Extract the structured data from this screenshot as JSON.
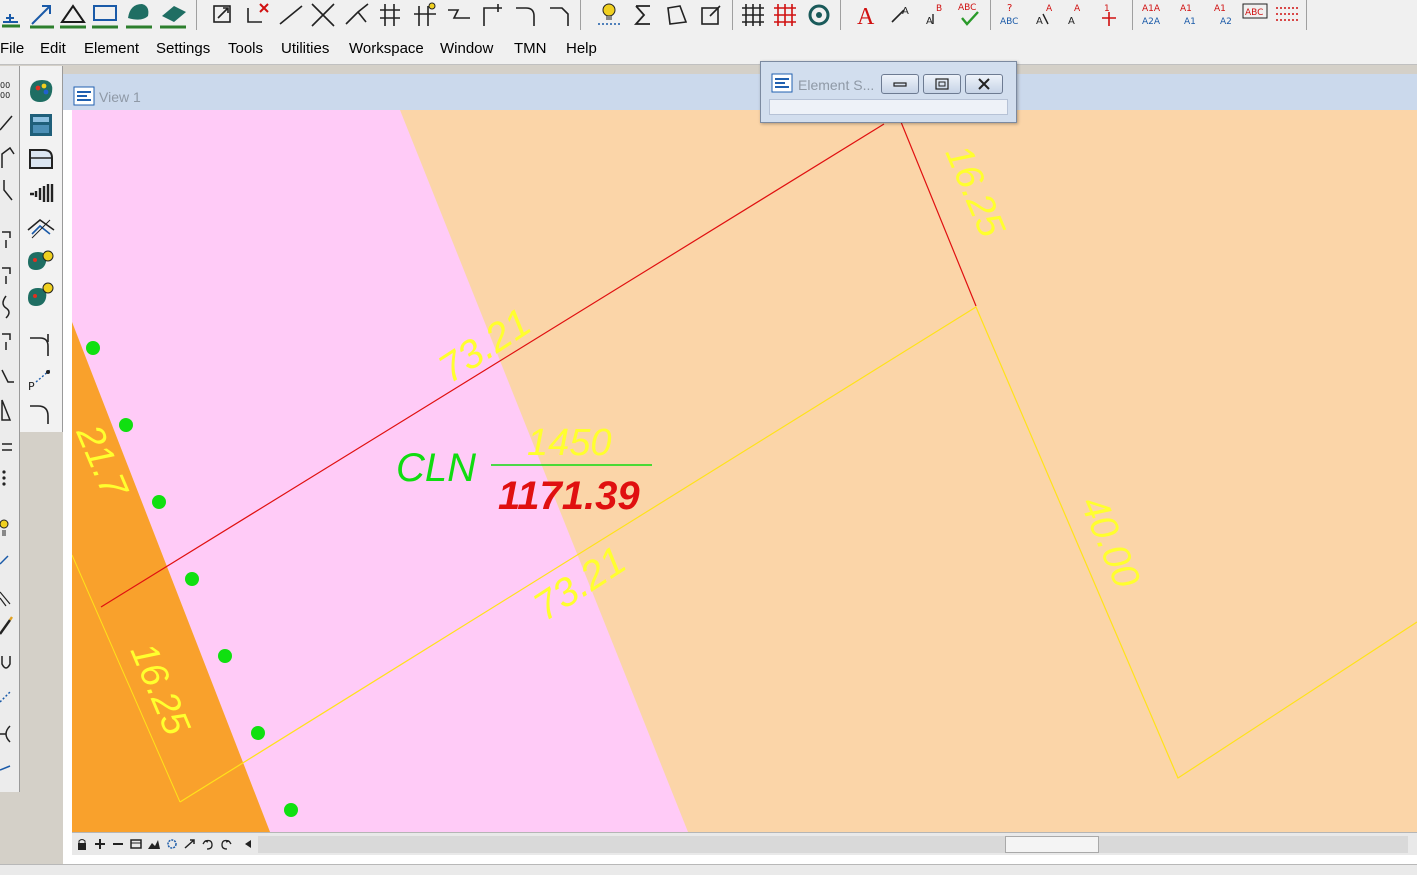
{
  "menu": {
    "items": [
      "File",
      "Edit",
      "Element",
      "Settings",
      "Tools",
      "Utilities",
      "Workspace",
      "Window",
      "TMN",
      "Help"
    ]
  },
  "toolbar_icons": {
    "text_tools": [
      "text-place-icon",
      "text-edit-icon",
      "text-spell-icon"
    ],
    "abc_labels": [
      "ABC",
      "ABC",
      "A1A",
      "A2A",
      "A1",
      "A1",
      "A1",
      "A2",
      "ABC"
    ]
  },
  "view": {
    "title": "View 1"
  },
  "element_window": {
    "title": "Element S..."
  },
  "drawing": {
    "colors": {
      "parcel_orange_light": "#fbd5a8",
      "parcel_pink": "#ffcbf7",
      "parcel_orange_dark": "#f9a12c",
      "boundary_red": "#e01010",
      "boundary_yellow": "#ffff2e",
      "point_green": "#10e010",
      "label_green": "#10dc10",
      "area_red": "#e01010"
    },
    "labels": {
      "top_dim": "73.21",
      "bottom_dim": "73.21",
      "right_top_dim": "16.25",
      "left_dim": "16.25",
      "right_dim": "40.00",
      "edge_partial": "21.7",
      "parcel_code": "CLN",
      "parcel_number": "1450",
      "parcel_area": "1171.39"
    }
  }
}
